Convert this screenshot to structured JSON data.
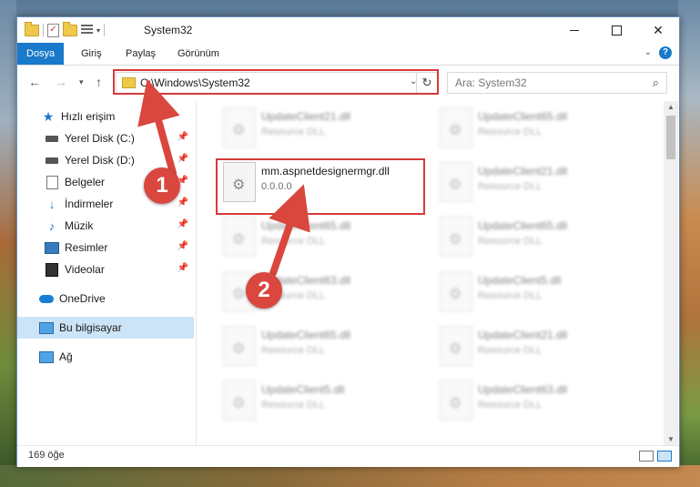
{
  "window": {
    "title": "System32",
    "controls": {
      "minimize": "—",
      "maximize": "☐",
      "close": "✕"
    }
  },
  "ribbon": {
    "tabs": [
      "Dosya",
      "Giriş",
      "Paylaş",
      "Görünüm"
    ],
    "help": "?"
  },
  "address": {
    "path": "C:\\Windows\\System32",
    "refresh_icon": "↻"
  },
  "search": {
    "placeholder": "Ara: System32"
  },
  "sidebar": {
    "items": [
      {
        "label": "Hızlı erişim"
      },
      {
        "label": "Yerel Disk (C:)"
      },
      {
        "label": "Yerel Disk (D:)"
      },
      {
        "label": "Belgeler"
      },
      {
        "label": "İndirmeler"
      },
      {
        "label": "Müzik"
      },
      {
        "label": "Resimler"
      },
      {
        "label": "Videolar"
      },
      {
        "label": "OneDrive"
      },
      {
        "label": "Bu bilgisayar"
      },
      {
        "label": "Ağ"
      }
    ]
  },
  "files": [
    {
      "name": "UpdateClient21.dll",
      "type": "Resource DLL"
    },
    {
      "name": "UpdateClient65.dll",
      "type": "Resource DLL"
    },
    {
      "name": "mm.aspnetdesignermgr.dll",
      "type": "0.0.0.0"
    },
    {
      "name": "UpdateClient21.dll",
      "type": "Resource DLL"
    },
    {
      "name": "UpdateClient65.dll",
      "type": "Resource DLL"
    },
    {
      "name": "UpdateClient65.dll",
      "type": "Resource DLL"
    },
    {
      "name": "UpdateClient63.dll",
      "type": "Resource DLL"
    },
    {
      "name": "UpdateClient5.dll",
      "type": "Resource DLL"
    },
    {
      "name": "UpdateClient65.dll",
      "type": "Resource DLL"
    },
    {
      "name": "UpdateClient21.dll",
      "type": "Resource DLL"
    },
    {
      "name": "UpdateClient5.dll",
      "type": "Resource DLL"
    },
    {
      "name": "UpdateClient63.dll",
      "type": "Resource DLL"
    }
  ],
  "status": {
    "count": "169 öğe"
  },
  "annotations": {
    "badge1": "1",
    "badge2": "2"
  },
  "colors": {
    "accent": "#1979ca",
    "highlight": "#d63a3a",
    "selected": "#cce4f7"
  }
}
